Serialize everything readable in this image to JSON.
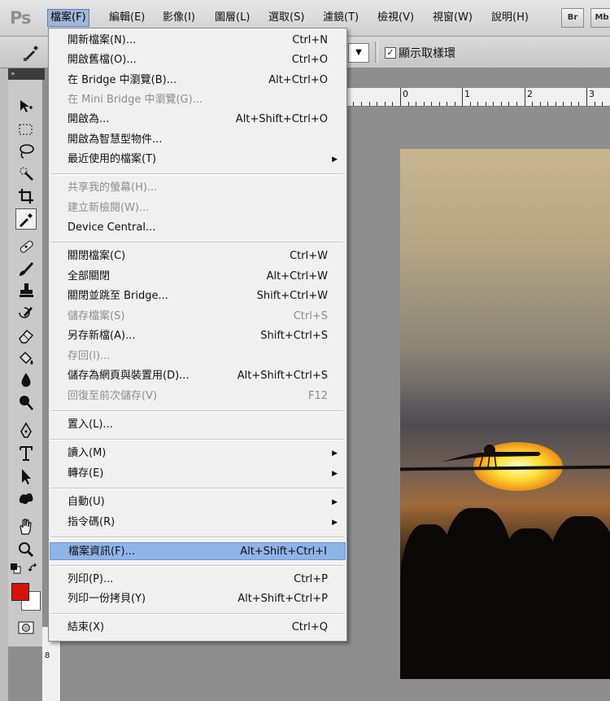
{
  "menubar": {
    "logo": "Ps",
    "items": [
      "檔案(F)",
      "編輯(E)",
      "影像(I)",
      "圖層(L)",
      "選取(S)",
      "濾鏡(T)",
      "檢視(V)",
      "視窗(W)",
      "說明(H)"
    ],
    "badges": [
      "Br",
      "Mb"
    ]
  },
  "options": {
    "sample_ring_label": "顯示取樣環",
    "sample_ring_checked": "✓",
    "dropdown_arrow": "▼"
  },
  "toolbox": {
    "collapse": "»",
    "fg_color": "#d4140a",
    "bg_color": "#ffffff"
  },
  "ruler": {
    "h_labels": [
      "0",
      "1",
      "2",
      "3"
    ],
    "v_label": "8"
  },
  "file_menu": {
    "items": [
      {
        "label": "開新檔案(N)...",
        "shortcut": "Ctrl+N"
      },
      {
        "label": "開啟舊檔(O)...",
        "shortcut": "Ctrl+O"
      },
      {
        "label": "在 Bridge 中瀏覽(B)...",
        "shortcut": "Alt+Ctrl+O"
      },
      {
        "label": "在 Mini Bridge 中瀏覽(G)...",
        "shortcut": ""
      },
      {
        "label": "開啟為...",
        "shortcut": "Alt+Shift+Ctrl+O"
      },
      {
        "label": "開啟為智慧型物件...",
        "shortcut": ""
      },
      {
        "label": "最近使用的檔案(T)",
        "shortcut": ""
      },
      {
        "label": "共享我的螢幕(H)...",
        "shortcut": ""
      },
      {
        "label": "建立新檢閱(W)...",
        "shortcut": ""
      },
      {
        "label": "Device Central...",
        "shortcut": ""
      },
      {
        "label": "關閉檔案(C)",
        "shortcut": "Ctrl+W"
      },
      {
        "label": "全部關閉",
        "shortcut": "Alt+Ctrl+W"
      },
      {
        "label": "關閉並跳至 Bridge...",
        "shortcut": "Shift+Ctrl+W"
      },
      {
        "label": "儲存檔案(S)",
        "shortcut": "Ctrl+S"
      },
      {
        "label": "另存新檔(A)...",
        "shortcut": "Shift+Ctrl+S"
      },
      {
        "label": "存回(I)...",
        "shortcut": ""
      },
      {
        "label": "儲存為網頁與裝置用(D)...",
        "shortcut": "Alt+Shift+Ctrl+S"
      },
      {
        "label": "回復至前次儲存(V)",
        "shortcut": "F12"
      },
      {
        "label": "置入(L)...",
        "shortcut": ""
      },
      {
        "label": "讀入(M)",
        "shortcut": ""
      },
      {
        "label": "轉存(E)",
        "shortcut": ""
      },
      {
        "label": "自動(U)",
        "shortcut": ""
      },
      {
        "label": "指令碼(R)",
        "shortcut": ""
      },
      {
        "label": "檔案資訊(F)...",
        "shortcut": "Alt+Shift+Ctrl+I"
      },
      {
        "label": "列印(P)...",
        "shortcut": "Ctrl+P"
      },
      {
        "label": "列印一份拷貝(Y)",
        "shortcut": "Alt+Shift+Ctrl+P"
      },
      {
        "label": "結束(X)",
        "shortcut": "Ctrl+Q"
      }
    ],
    "submenu_arrow": "▶"
  }
}
